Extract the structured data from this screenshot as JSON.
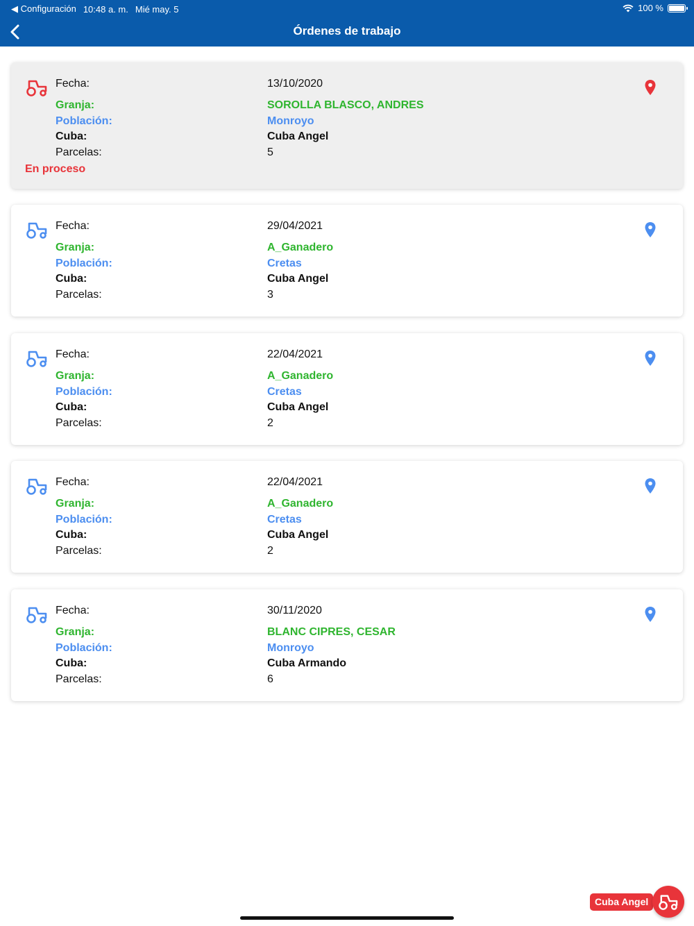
{
  "status_bar": {
    "back_app": "◀ Configuración",
    "time": "10:48 a. m.",
    "date": "Mié may. 5",
    "battery": "100 %"
  },
  "nav": {
    "title": "Órdenes de trabajo"
  },
  "labels": {
    "fecha": "Fecha:",
    "granja": "Granja:",
    "poblacion": "Población:",
    "cuba": "Cuba:",
    "parcelas": "Parcelas:"
  },
  "orders": [
    {
      "fecha": "13/10/2020",
      "granja": "SOROLLA BLASCO, ANDRES",
      "poblacion": "Monroyo",
      "cuba": "Cuba Angel",
      "parcelas": "5",
      "status": "En proceso"
    },
    {
      "fecha": "29/04/2021",
      "granja": "A_Ganadero",
      "poblacion": "Cretas",
      "cuba": "Cuba Angel",
      "parcelas": "3"
    },
    {
      "fecha": "22/04/2021",
      "granja": "A_Ganadero",
      "poblacion": "Cretas",
      "cuba": "Cuba Angel",
      "parcelas": "2"
    },
    {
      "fecha": "22/04/2021",
      "granja": "A_Ganadero",
      "poblacion": "Cretas",
      "cuba": "Cuba Angel",
      "parcelas": "2"
    },
    {
      "fecha": "30/11/2020",
      "granja": "BLANC CIPRES, CESAR",
      "poblacion": "Monroyo",
      "cuba": "Cuba Armando",
      "parcelas": "6"
    }
  ],
  "fab": {
    "label": "Cuba Angel"
  },
  "colors": {
    "nav": "#0a5bab",
    "green": "#2fb52f",
    "blue": "#4c8ef0",
    "red": "#e8343a"
  },
  "icons": {
    "back": "chevron-left-icon",
    "tractor": "tractor-icon",
    "pin": "map-pin-icon",
    "wifi": "wifi-icon",
    "battery": "battery-icon"
  }
}
